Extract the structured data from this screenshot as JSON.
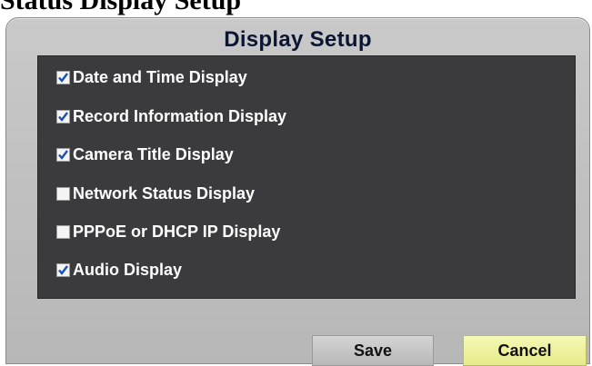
{
  "page": {
    "heading": "Status Display Setup"
  },
  "dialog": {
    "title": "Display Setup",
    "options": [
      {
        "label": "Date and Time Display",
        "checked": true
      },
      {
        "label": "Record Information Display",
        "checked": true
      },
      {
        "label": "Camera Title Display",
        "checked": true
      },
      {
        "label": "Network Status Display",
        "checked": false
      },
      {
        "label": "PPPoE or DHCP IP Display",
        "checked": false
      },
      {
        "label": "Audio Display",
        "checked": true
      }
    ],
    "buttons": {
      "save": "Save",
      "cancel": "Cancel"
    }
  },
  "colors": {
    "panel": "#3b3a3c",
    "check_mark": "#1a4fb5",
    "cancel_highlight": "#e9ee92"
  }
}
